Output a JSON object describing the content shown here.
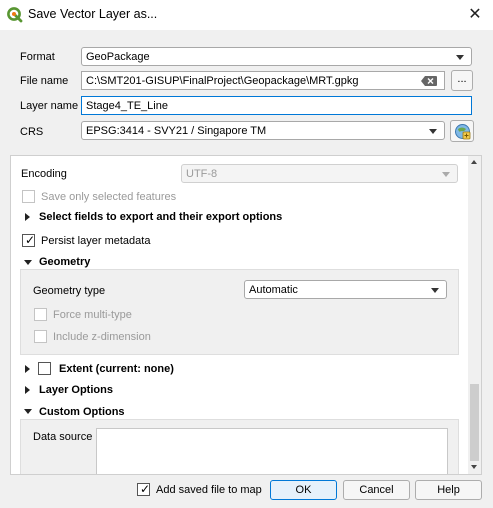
{
  "window": {
    "title": "Save Vector Layer as...",
    "close_label": "✕"
  },
  "form": {
    "format": {
      "label": "Format",
      "value": "GeoPackage"
    },
    "file_name": {
      "label": "File name",
      "value": "C:\\SMT201-GISUP\\FinalProject\\Geopackage\\MRT.gpkg",
      "browse_label": "..."
    },
    "layer_name": {
      "label": "Layer name",
      "value": "Stage4_TE_Line"
    },
    "crs": {
      "label": "CRS",
      "value": "EPSG:3414 - SVY21 / Singapore TM"
    }
  },
  "options": {
    "encoding": {
      "label": "Encoding",
      "value": "UTF-8"
    },
    "save_selected": {
      "label": "Save only selected features",
      "checked": false,
      "enabled": false
    },
    "select_fields": {
      "label": "Select fields to export and their export options",
      "expanded": false
    },
    "persist_metadata": {
      "label": "Persist layer metadata",
      "checked": true
    },
    "geometry": {
      "label": "Geometry",
      "expanded": true,
      "type_label": "Geometry type",
      "type_value": "Automatic",
      "force_multi": {
        "label": "Force multi-type",
        "checked": false,
        "enabled": false
      },
      "include_z": {
        "label": "Include z-dimension",
        "checked": false,
        "enabled": false
      }
    },
    "extent": {
      "label": "Extent (current: none)",
      "expanded": false,
      "checked": false
    },
    "layer_options": {
      "label": "Layer Options",
      "expanded": false
    },
    "custom_options": {
      "label": "Custom Options",
      "expanded": true,
      "data_source_label": "Data source",
      "data_source_value": ""
    }
  },
  "footer": {
    "add_to_map": {
      "label": "Add saved file to map",
      "checked": true
    },
    "ok_label": "OK",
    "cancel_label": "Cancel",
    "help_label": "Help"
  },
  "icons": {
    "app": "qgis-logo-icon",
    "clear": "clear-text-icon",
    "crs_picker": "globe-projection-icon"
  },
  "colors": {
    "accent": "#589632",
    "focus_border": "#0078d7",
    "ok_border": "#0078d7"
  }
}
